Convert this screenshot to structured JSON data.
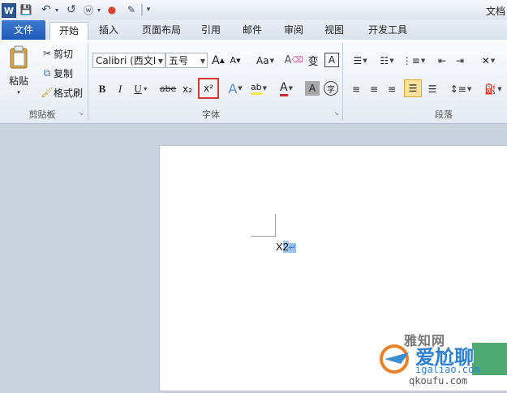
{
  "app": {
    "logo_letter": "W",
    "document_title": "文档"
  },
  "quick_access": {
    "save": "💾",
    "undo": "↶",
    "redo": "↺",
    "format": "ⓦ",
    "color": "●",
    "draw": "✎",
    "customize": "▾"
  },
  "tabs": {
    "file": "文件",
    "home": "开始",
    "insert": "插入",
    "page_layout": "页面布局",
    "references": "引用",
    "mailings": "邮件",
    "review": "审阅",
    "view": "视图",
    "developer": "开发工具"
  },
  "clipboard": {
    "paste_label": "粘贴",
    "cut_label": "剪切",
    "copy_label": "复制",
    "format_painter_label": "格式刷",
    "group_label": "剪贴板"
  },
  "font": {
    "font_name": "Calibri (西文I",
    "font_size": "五号",
    "grow": "A",
    "shrink": "A",
    "change_case": "Aa",
    "clear_format": "A",
    "phonetic": "变",
    "border": "A",
    "bold": "B",
    "italic": "I",
    "underline": "U",
    "strikethrough": "abe",
    "subscript": "x₂",
    "superscript": "x²",
    "text_effects": "A",
    "highlight": "ab",
    "font_color": "A",
    "char_shading": "A",
    "enclose": "字",
    "group_label": "字体"
  },
  "paragraph": {
    "group_label": "段落"
  },
  "document": {
    "text": "X2",
    "paragraph_mark": "↵"
  },
  "watermark": {
    "line1": "雅知网",
    "line2": "爱尬聊",
    "url": "igaliao.com",
    "url2": "qkoufu.com"
  }
}
